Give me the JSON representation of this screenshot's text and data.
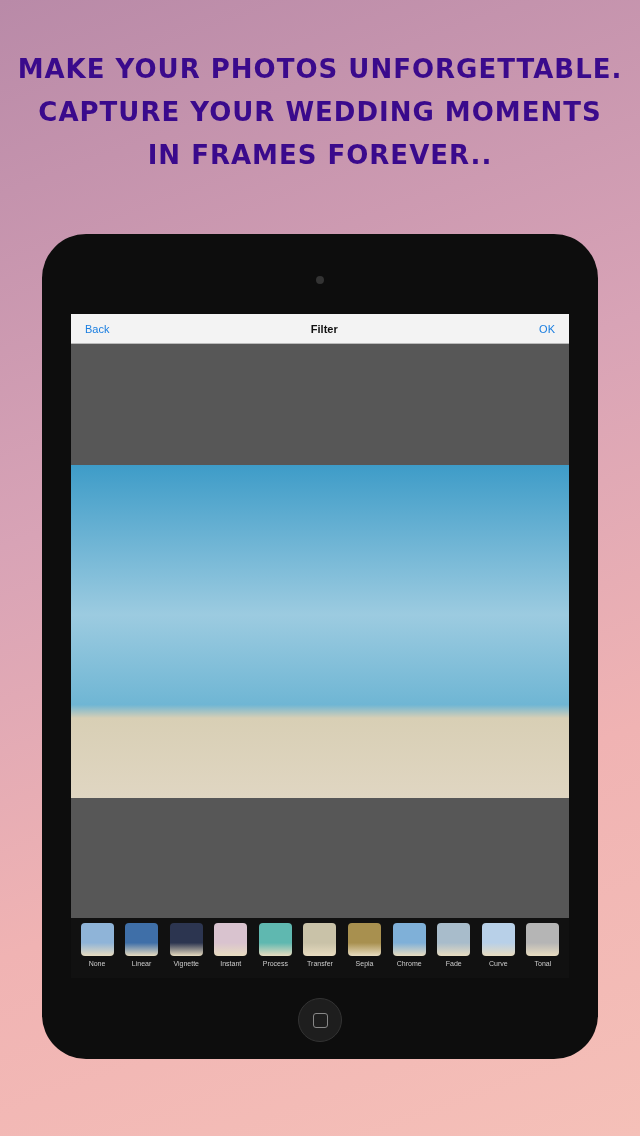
{
  "headline_lines": [
    "MAKE YOUR PHOTOS UNFORGETTABLE.",
    "CAPTURE YOUR WEDDING MOMENTS",
    "IN FRAMES FOREVER.."
  ],
  "nav_bar": {
    "back": "Back",
    "title": "Filter",
    "ok": "OK"
  },
  "filters": [
    {
      "label": "None",
      "color": "#8fb4d8"
    },
    {
      "label": "Linear",
      "color": "#3f6fa8"
    },
    {
      "label": "Vignette",
      "color": "#2c3550"
    },
    {
      "label": "Instant",
      "color": "#d9c3cf"
    },
    {
      "label": "Process",
      "color": "#5fb8b0"
    },
    {
      "label": "Transfer",
      "color": "#c9c2a8"
    },
    {
      "label": "Sepia",
      "color": "#a8904f"
    },
    {
      "label": "Chrome",
      "color": "#7fb0d8"
    },
    {
      "label": "Fade",
      "color": "#a8bccb"
    },
    {
      "label": "Curve",
      "color": "#b8d0e8"
    },
    {
      "label": "Tonal",
      "color": "#b5b5b5"
    }
  ]
}
